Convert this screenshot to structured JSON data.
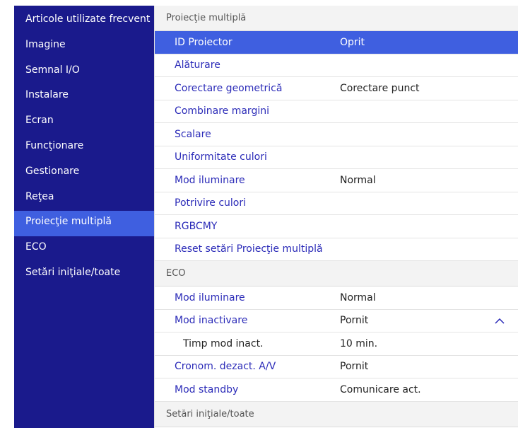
{
  "sidebar": {
    "items": [
      {
        "label": "Articole utilizate frecvent"
      },
      {
        "label": "Imagine"
      },
      {
        "label": "Semnal I/O"
      },
      {
        "label": "Instalare"
      },
      {
        "label": "Ecran"
      },
      {
        "label": "Funcţionare"
      },
      {
        "label": "Gestionare"
      },
      {
        "label": "Reţea"
      },
      {
        "label": "Proiecţie multiplă"
      },
      {
        "label": "ECO"
      },
      {
        "label": "Setări iniţiale/toate"
      }
    ],
    "active_index": 8
  },
  "main": {
    "sections": [
      {
        "header": "Proiecţie multiplă",
        "rows": [
          {
            "label": "ID Proiector",
            "value": "Oprit"
          },
          {
            "label": "Alăturare",
            "value": ""
          },
          {
            "label": "Corectare geometrică",
            "value": "Corectare punct"
          },
          {
            "label": "Combinare margini",
            "value": ""
          },
          {
            "label": "Scalare",
            "value": ""
          },
          {
            "label": "Uniformitate culori",
            "value": ""
          },
          {
            "label": "Mod iluminare",
            "value": "Normal"
          },
          {
            "label": "Potrivire culori",
            "value": ""
          },
          {
            "label": "RGBCMY",
            "value": ""
          },
          {
            "label": "Reset setări Proiecţie multiplă",
            "value": ""
          }
        ]
      },
      {
        "header": "ECO",
        "rows": [
          {
            "label": "Mod iluminare",
            "value": "Normal"
          },
          {
            "label": "Mod inactivare",
            "value": "Pornit"
          },
          {
            "label": "Timp mod inact.",
            "value": "10 min."
          },
          {
            "label": "Cronom. dezact. A/V",
            "value": "Pornit"
          },
          {
            "label": "Mod standby",
            "value": "Comunicare act."
          }
        ]
      },
      {
        "header": "Setări iniţiale/toate",
        "rows": []
      }
    ],
    "selected_row": "ID Proiector",
    "collapse_icon": "chevron-up-icon"
  },
  "colors": {
    "sidebar_bg": "#1a1a8c",
    "highlight": "#3f5fe0",
    "link_text": "#2b2bb8",
    "section_bg": "#f3f3f3"
  }
}
